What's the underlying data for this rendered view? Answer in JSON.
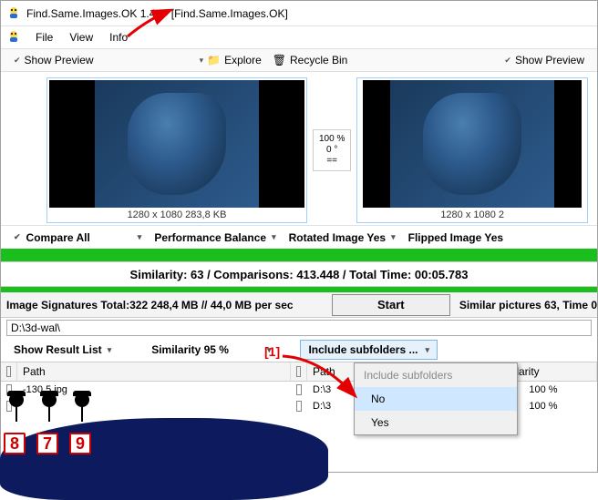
{
  "titlebar": {
    "title": "Find.Same.Images.OK 1.44 - [Find.Same.Images.OK]"
  },
  "menu": {
    "file": "File",
    "view": "View",
    "info": "Info"
  },
  "toolbar": {
    "show_preview": "Show Preview",
    "explore": "Explore",
    "recycle": "Recycle Bin",
    "show_preview2": "Show Preview"
  },
  "preview": {
    "caption_left": "1280 x 1080 283,8 KB",
    "caption_right": "1280 x 1080 2",
    "zoom_pct": "100 %",
    "zoom_deg": "0 °",
    "zoom_eq": "=="
  },
  "options": {
    "compare_all": "Compare All",
    "perf": "Performance Balance",
    "rotated": "Rotated Image Yes",
    "flipped": "Flipped Image Yes"
  },
  "stats": "Similarity: 63 / Comparisons: 413.448 / Total Time: 00:05.783",
  "signatures": {
    "label": "Image Signatures Total:322  248,4 MB // 44,0 MB per sec",
    "start": "Start",
    "similar": "Similar pictures 63, Time 0"
  },
  "path": "D:\\3d-wal\\",
  "resultctrls": {
    "show_result": "Show Result List",
    "similarity": "Similarity 95 %",
    "include_sub": "Include subfolders ..."
  },
  "popup": {
    "header": "Include subfolders",
    "no": "No",
    "yes": "Yes"
  },
  "table": {
    "col_path1": "Path",
    "col_path2": "Path",
    "col_sim": "Similarity",
    "row1_left": "-130      5.jpg",
    "row1_right": "D:\\3",
    "row1_sim": "100 %",
    "row2_left": "",
    "row2_right": "D:\\3",
    "row2_sim": "100 %"
  },
  "annotation": "[1]",
  "stick_nums": [
    "8",
    "7",
    "9"
  ]
}
